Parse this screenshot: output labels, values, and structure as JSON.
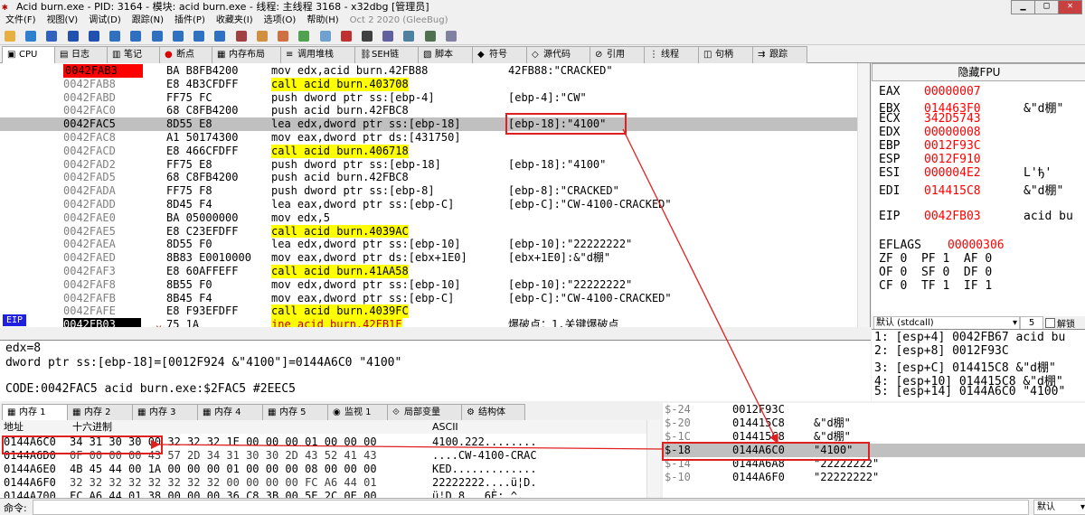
{
  "window": {
    "title": "Acid burn.exe - PID: 3164 - 模块: acid burn.exe - 线程: 主线程 3168 - x32dbg [管理员]"
  },
  "menu": [
    "文件(F)",
    "视图(V)",
    "调试(D)",
    "跟踪(N)",
    "插件(P)",
    "收藏夹(I)",
    "选项(O)",
    "帮助(H)"
  ],
  "version": "Oct 2 2020 (GleeBug)",
  "tabs": [
    {
      "label": "CPU",
      "icon": "cpu-icon"
    },
    {
      "label": "日志",
      "icon": "log-icon"
    },
    {
      "label": "笔记",
      "icon": "notes-icon"
    },
    {
      "label": "断点",
      "icon": "breakpoint-icon"
    },
    {
      "label": "内存布局",
      "icon": "memory-map-icon"
    },
    {
      "label": "调用堆栈",
      "icon": "callstack-icon"
    },
    {
      "label": "SEH链",
      "icon": "seh-icon"
    },
    {
      "label": "脚本",
      "icon": "script-icon"
    },
    {
      "label": "符号",
      "icon": "symbol-icon"
    },
    {
      "label": "源代码",
      "icon": "source-icon"
    },
    {
      "label": "引用",
      "icon": "references-icon"
    },
    {
      "label": "线程",
      "icon": "threads-icon"
    },
    {
      "label": "句柄",
      "icon": "handles-icon"
    },
    {
      "label": "跟踪",
      "icon": "trace-icon"
    }
  ],
  "disasm": [
    {
      "addr": "0042FAB3",
      "bytes": "BA B8FB4200",
      "ins": "mov edx,acid burn.42FB88",
      "cmt": "42FB88:\"CRACKED\"",
      "bp": true
    },
    {
      "addr": "0042FAB8",
      "bytes": "E8 4B3CFDFF",
      "ins": "call acid burn.403708",
      "cmt": "",
      "call": true
    },
    {
      "addr": "0042FABD",
      "bytes": "FF75 FC",
      "ins": "push dword ptr ss:[ebp-4]",
      "cmt": "[ebp-4]:\"CW\""
    },
    {
      "addr": "0042FAC0",
      "bytes": "68 C8FB4200",
      "ins": "push acid burn.42FBC8",
      "cmt": ""
    },
    {
      "addr": "0042FAC5",
      "bytes": "8D55 E8",
      "ins": "lea edx,dword ptr ss:[ebp-18]",
      "cmt": "[ebp-18]:\"4100\"",
      "sel": true
    },
    {
      "addr": "0042FAC8",
      "bytes": "A1 50174300",
      "ins": "mov eax,dword ptr ds:[431750]",
      "cmt": ""
    },
    {
      "addr": "0042FACD",
      "bytes": "E8 466CFDFF",
      "ins": "call acid burn.406718",
      "cmt": "",
      "call": true
    },
    {
      "addr": "0042FAD2",
      "bytes": "FF75 E8",
      "ins": "push dword ptr ss:[ebp-18]",
      "cmt": "[ebp-18]:\"4100\""
    },
    {
      "addr": "0042FAD5",
      "bytes": "68 C8FB4200",
      "ins": "push acid burn.42FBC8",
      "cmt": ""
    },
    {
      "addr": "0042FADA",
      "bytes": "FF75 F8",
      "ins": "push dword ptr ss:[ebp-8]",
      "cmt": "[ebp-8]:\"CRACKED\""
    },
    {
      "addr": "0042FADD",
      "bytes": "8D45 F4",
      "ins": "lea eax,dword ptr ss:[ebp-C]",
      "cmt": "[ebp-C]:\"CW-4100-CRACKED\""
    },
    {
      "addr": "0042FAE0",
      "bytes": "BA 05000000",
      "ins": "mov edx,5",
      "cmt": ""
    },
    {
      "addr": "0042FAE5",
      "bytes": "E8 C23EFDFF",
      "ins": "call acid burn.4039AC",
      "cmt": "",
      "call": true
    },
    {
      "addr": "0042FAEA",
      "bytes": "8D55 F0",
      "ins": "lea edx,dword ptr ss:[ebp-10]",
      "cmt": "[ebp-10]:\"22222222\""
    },
    {
      "addr": "0042FAED",
      "bytes": "8B83 E0010000",
      "ins": "mov eax,dword ptr ds:[ebx+1E0]",
      "cmt": "[ebx+1E0]:&\"d棚\""
    },
    {
      "addr": "0042FAF3",
      "bytes": "E8 60AFFEFF",
      "ins": "call acid burn.41AA58",
      "cmt": "",
      "call": true
    },
    {
      "addr": "0042FAF8",
      "bytes": "8B55 F0",
      "ins": "mov edx,dword ptr ss:[ebp-10]",
      "cmt": "[ebp-10]:\"22222222\""
    },
    {
      "addr": "0042FAFB",
      "bytes": "8B45 F4",
      "ins": "mov eax,dword ptr ss:[ebp-C]",
      "cmt": "[ebp-C]:\"CW-4100-CRACKED\""
    },
    {
      "addr": "0042FAFE",
      "bytes": "E8 F93EFDFF",
      "ins": "call acid burn.4039FC",
      "cmt": "",
      "call": true
    },
    {
      "addr": "0042FB03",
      "bytes": "75 1A",
      "ins": "jne acid burn.42FB1F",
      "cmt": "爆破点：1.关键爆破点",
      "cur": true
    }
  ],
  "eip_label": "EIP",
  "info": [
    "edx=8",
    "dword ptr ss:[ebp-18]=[0012F924 &\"4100\"]=0144A6C0 \"4100\"",
    "",
    "CODE:0042FAC5 acid burn.exe:$2FAC5 #2EEC5"
  ],
  "fpu_header": "隐藏FPU",
  "registers": [
    {
      "n": "EAX",
      "v": "00000007",
      "c": ""
    },
    {
      "n": "EBX",
      "v": "014463F0",
      "c": "&\"d棚\""
    },
    {
      "n": "ECX",
      "v": "342D5743",
      "c": ""
    },
    {
      "n": "EDX",
      "v": "00000008",
      "c": ""
    },
    {
      "n": "EBP",
      "v": "0012F93C",
      "c": ""
    },
    {
      "n": "ESP",
      "v": "0012F910",
      "c": ""
    },
    {
      "n": "ESI",
      "v": "000004E2",
      "c": "L'ђ'"
    },
    {
      "n": "EDI",
      "v": "014415C8",
      "c": "&\"d棚\""
    },
    {
      "n": "",
      "v": "",
      "c": ""
    },
    {
      "n": "EIP",
      "v": "0042FB03",
      "c": "acid bu"
    },
    {
      "n": "",
      "v": "",
      "c": ""
    },
    {
      "n": "EFLAGS",
      "v": "00000306",
      "c": ""
    },
    {
      "n": "ZF 0  PF 1  AF 0",
      "v": "",
      "c": ""
    },
    {
      "n": "OF 0  SF 0  DF 0",
      "v": "",
      "c": ""
    },
    {
      "n": "CF 0  TF 1  IF 1",
      "v": "",
      "c": ""
    }
  ],
  "callconv": {
    "value": "默认 (stdcall)",
    "count": "5",
    "unlock": "解锁"
  },
  "args": [
    "1: [esp+4] 0042FB67 acid bu",
    "2: [esp+8] 0012F93C",
    "3: [esp+C] 014415C8 &\"d棚\"",
    "4: [esp+10] 014415C8 &\"d棚\"",
    "5: [esp+14] 0144A6C0 \"4100\""
  ],
  "bottom_tabs": [
    "内存 1",
    "内存 2",
    "内存 3",
    "内存 4",
    "内存 5",
    "监视 1",
    "局部变量",
    "结构体"
  ],
  "dump_headers": {
    "addr": "地址",
    "hex": "十六进制",
    "ascii": "ASCII"
  },
  "dump": [
    {
      "a": "0144A6C0",
      "h": "34 31 30 30 00 32 32 32 1E 00 00 00 01 00 00 00",
      "s": "4100.222........"
    },
    {
      "a": "0144A6D0",
      "h": "0F 00 00 00 43 57 2D 34 31 30 30 2D 43 52 41 43",
      "s": "....CW-4100-CRAC"
    },
    {
      "a": "0144A6E0",
      "h": "4B 45 44 00 1A 00 00 00 01 00 00 00 08 00 00 00",
      "s": "KED............."
    },
    {
      "a": "0144A6F0",
      "h": "32 32 32 32 32 32 32 32 00 00 00 00 FC A6 44 01",
      "s": "22222222....ü¦D."
    },
    {
      "a": "0144A700",
      "h": "FC A6 44 01 38 00 00 00 36 C8 3B 00 5E 2C 0E 00",
      "s": "ü¦D.8...6È;.^,.."
    }
  ],
  "stack": [
    {
      "o": "$-24",
      "v": "0012F93C",
      "c": ""
    },
    {
      "o": "$-20",
      "v": "014415C8",
      "c": "&\"d棚\""
    },
    {
      "o": "$-1C",
      "v": "014415C8",
      "c": "&\"d棚\""
    },
    {
      "o": "$-18",
      "v": "0144A6C0",
      "c": "\"4100\"",
      "sel": true
    },
    {
      "o": "$-14",
      "v": "0144A6A8",
      "c": "\"22222222\""
    },
    {
      "o": "$-10",
      "v": "0144A6F0",
      "c": "\"22222222\""
    }
  ],
  "cmd": {
    "label": "命令:",
    "mode": "默认"
  },
  "colors": {
    "highlight": "#ff0000",
    "call_bg": "#ffff00",
    "selection": "#c0c0c0",
    "annotation": "#e02020"
  }
}
